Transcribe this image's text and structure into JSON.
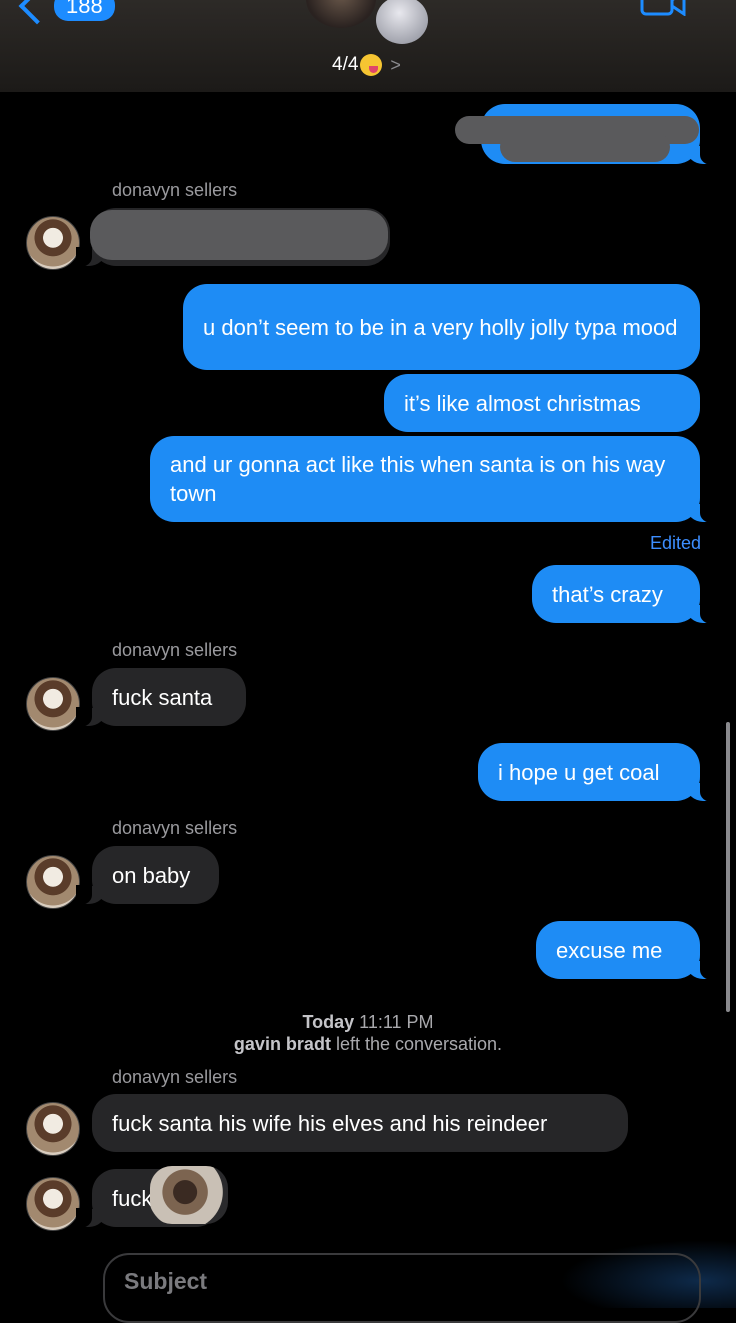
{
  "header": {
    "back_count": "188",
    "group_count": "4/4",
    "emoji": "zany-face-emoji",
    "chevron": ">"
  },
  "messages": {
    "sender_1": "donavyn sellers",
    "sent_1": "u don’t seem to be in a very holly jolly typa mood",
    "sent_2": "it’s like almost christmas",
    "sent_3": "and ur gonna act like this when santa is on his way town",
    "edited": "Edited",
    "sent_4": "that’s crazy",
    "sender_2": "donavyn sellers",
    "recv_1": "fuck santa",
    "sent_5": "i hope u get coal",
    "sender_3": "donavyn sellers",
    "recv_2": "on baby",
    "sent_6": "excuse me",
    "sender_4": "donavyn sellers",
    "recv_3": "fuck santa his wife his elves and his reindeer",
    "recv_4": "fuck"
  },
  "timestamp": {
    "date": "Today",
    "time": "11:11 PM",
    "left_name": "gavin bradt",
    "left_text": "left the conversation."
  },
  "composer": {
    "subject_placeholder": "Subject"
  },
  "colors": {
    "sent_bubble": "#1e8cf5",
    "received_bubble": "#262628",
    "accent": "#1d8cff"
  }
}
